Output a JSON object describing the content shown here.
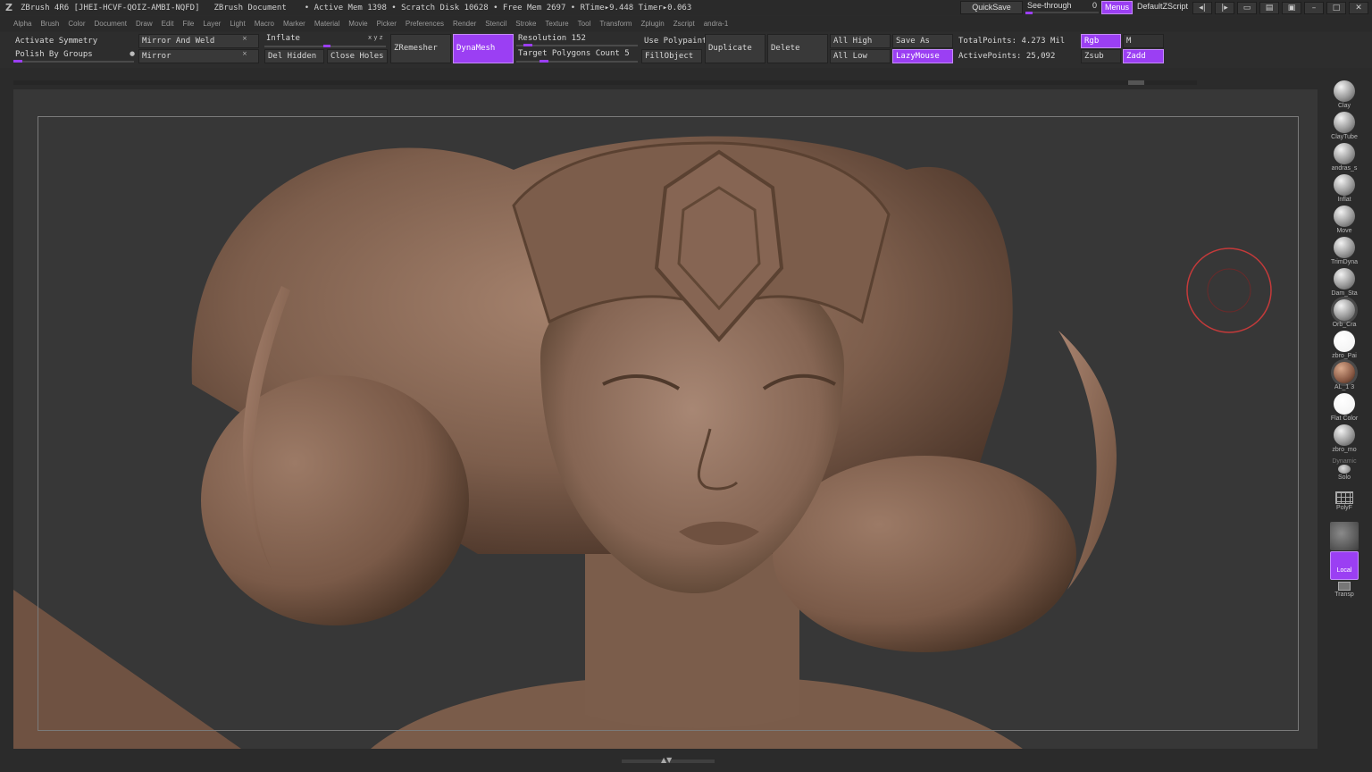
{
  "title": {
    "app": "ZBrush 4R6 [JHEI-HCVF-QOIZ-AMBI-NQFD]",
    "document": "ZBrush Document",
    "stats": "• Active Mem 1398 • Scratch Disk 10628 • Free Mem 2697 • RTime▸9.448 Timer▸0.063"
  },
  "titlebar_right": {
    "quicksave": "QuickSave",
    "see_through_label": "See-through",
    "see_through_value": "0",
    "see_through_level": 0.0,
    "menus": "Menus",
    "default_zscript": "DefaultZScript"
  },
  "menus": [
    "Alpha",
    "Brush",
    "Color",
    "Document",
    "Draw",
    "Edit",
    "File",
    "Layer",
    "Light",
    "Macro",
    "Marker",
    "Material",
    "Movie",
    "Picker",
    "Preferences",
    "Render",
    "Stencil",
    "Stroke",
    "Texture",
    "Tool",
    "Transform",
    "Zplugin",
    "Zscript",
    "andra-1"
  ],
  "palette": {
    "activate_symmetry": "Activate Symmetry",
    "polish_by_groups": "Polish By Groups",
    "mirror_and_weld": "Mirror And Weld",
    "mirror": "Mirror",
    "inflate": "Inflate",
    "inflate_axes": "x y z",
    "del_hidden": "Del Hidden",
    "close_holes": "Close Holes",
    "zremesher": "ZRemesher",
    "dynamesh": "DynaMesh",
    "resolution": "Resolution 152",
    "target_polygons": "Target Polygons Count 5",
    "use_polypaint": "Use Polypaint",
    "fill_object": "FillObject",
    "duplicate": "Duplicate",
    "delete": "Delete",
    "all_high": "All High",
    "all_low": "All Low",
    "save_as": "Save As",
    "lazymouse": "LazyMouse",
    "total_points": "TotalPoints: 4.273 Mil",
    "active_points": "ActivePoints: 25,092",
    "rgb": "Rgb",
    "m": "M",
    "zsub": "Zsub",
    "zadd": "Zadd"
  },
  "shelf": [
    {
      "label": "Clay",
      "icon": "clay-brush-icon"
    },
    {
      "label": "ClayTube",
      "icon": "claytubes-brush-icon"
    },
    {
      "label": "andras_s",
      "icon": "custom-brush-icon"
    },
    {
      "label": "Inflat",
      "icon": "inflate-brush-icon"
    },
    {
      "label": "Move",
      "icon": "move-brush-icon"
    },
    {
      "label": "TrimDyna",
      "icon": "trimdynamic-brush-icon"
    },
    {
      "label": "Dam_Sta",
      "icon": "damstandard-brush-icon"
    },
    {
      "label": "Orb_Cra",
      "icon": "orb-cracks-brush-icon"
    },
    {
      "label": "zbro_Pai",
      "icon": "paint-material-icon"
    },
    {
      "label": "AL_1 3",
      "icon": "skin-material-icon"
    },
    {
      "label": "Flat Color",
      "icon": "flat-color-material-icon"
    },
    {
      "label": "zbro_mo",
      "icon": "matcap-material-icon"
    },
    {
      "label": "Dynamic",
      "icon": "dynamic-icon"
    },
    {
      "label": "Solo",
      "icon": "solo-icon"
    },
    {
      "label": "PolyF",
      "icon": "polyframe-icon"
    },
    {
      "label": "BPR",
      "icon": "bpr-render-icon"
    },
    {
      "label": "Local",
      "icon": "local-symmetry-icon"
    },
    {
      "label": "Transp",
      "icon": "transparency-icon"
    }
  ],
  "colors": {
    "accent": "#9b3ff3",
    "clay": "#8a6a58",
    "background": "#373737",
    "brush_cursor": "#c43a3a"
  }
}
